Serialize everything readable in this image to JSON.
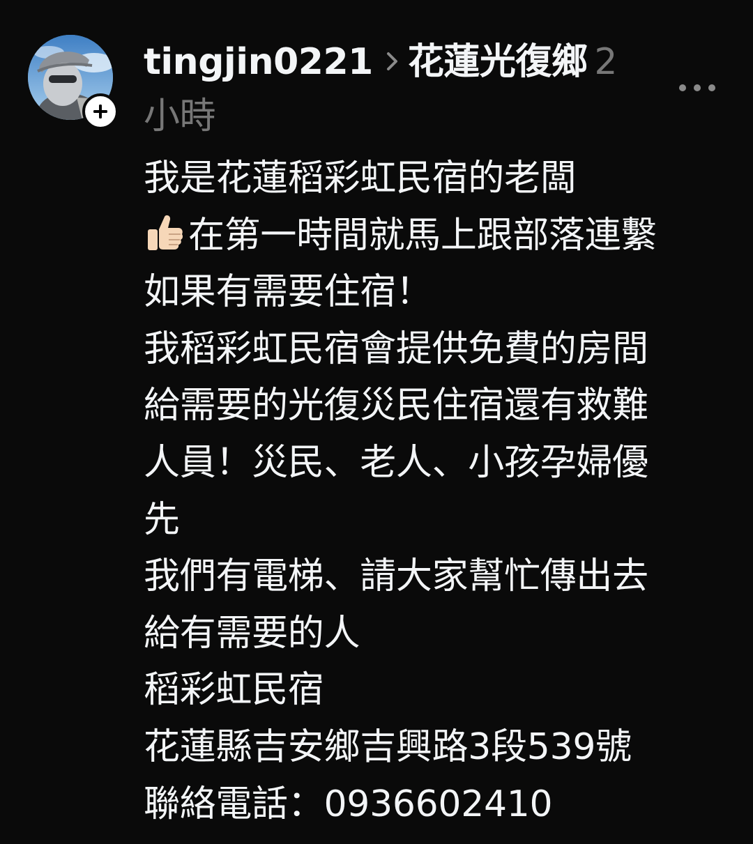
{
  "post": {
    "username": "tingjin0221",
    "location": "花蓮光復鄉",
    "time_ago": "2 小時",
    "avatar_icon": "profile-photo",
    "follow_icon": "plus-icon",
    "more_icon": "more-horizontal-icon",
    "lines": [
      "我是花蓮稻彩虹民宿的老闆",
      "在第一時間就馬上跟部落連繫",
      "如果有需要住宿！",
      "我稻彩虹民宿會提供免費的房間",
      "給需要的光復災民住宿還有救難",
      "人員！災民、老人、小孩孕婦優",
      "先",
      "我們有電梯、請大家幫忙傳出去",
      "給有需要的人",
      "稻彩虹民宿",
      "花蓮縣吉安鄉吉興路3段539號",
      "聯絡電話：0936602410"
    ],
    "emoji": {
      "name": "thumbs-up-icon",
      "skin_color": "#f6d7b8"
    }
  },
  "colors": {
    "background": "#0a0a0a",
    "text": "#f3f5f7",
    "muted": "#777777"
  }
}
